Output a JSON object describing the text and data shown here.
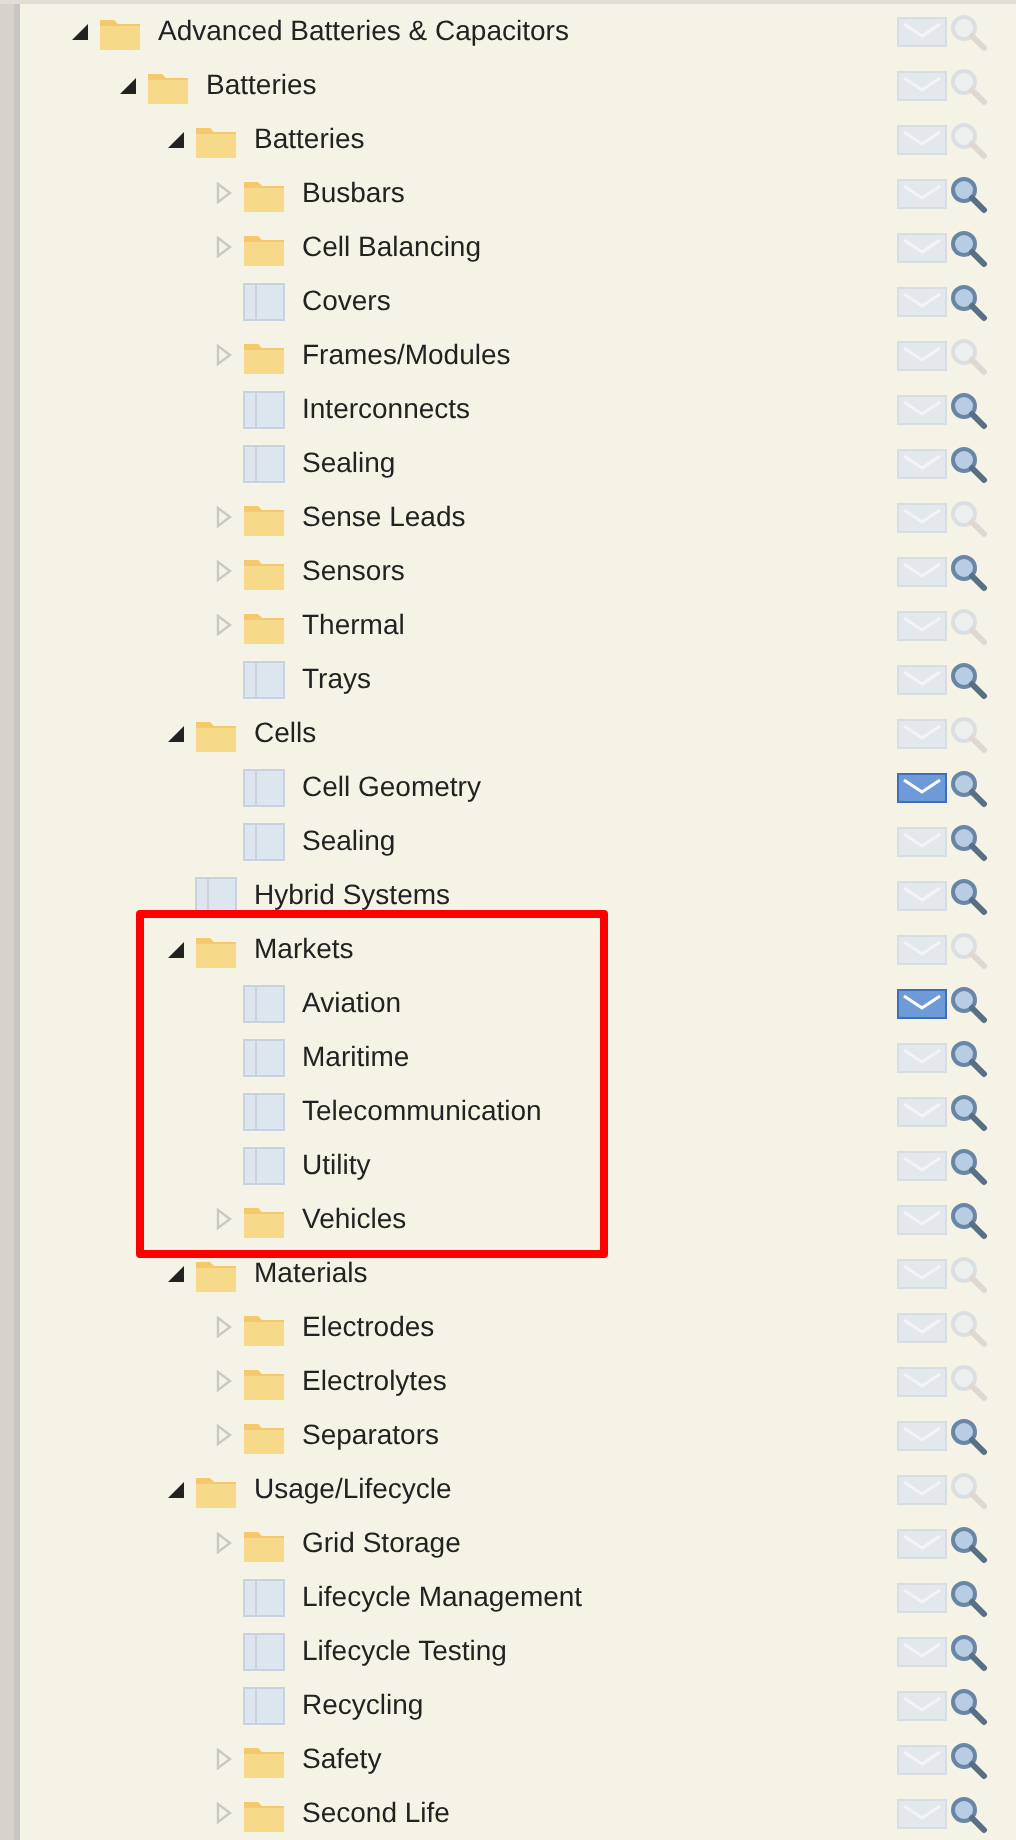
{
  "tree": [
    {
      "label": "Advanced Batteries & Capacitors",
      "kind": "folder",
      "expanded": true,
      "subscribed": false,
      "search_enabled": false,
      "children": [
        {
          "label": "Batteries",
          "kind": "folder",
          "expanded": true,
          "subscribed": false,
          "search_enabled": false,
          "children": [
            {
              "label": "Batteries",
              "kind": "folder",
              "expanded": true,
              "subscribed": false,
              "search_enabled": false,
              "children": [
                {
                  "label": "Busbars",
                  "kind": "folder",
                  "expanded": false,
                  "subscribed": false,
                  "search_enabled": true
                },
                {
                  "label": "Cell Balancing",
                  "kind": "folder",
                  "expanded": false,
                  "subscribed": false,
                  "search_enabled": true
                },
                {
                  "label": "Covers",
                  "kind": "document",
                  "subscribed": false,
                  "search_enabled": true
                },
                {
                  "label": "Frames/Modules",
                  "kind": "folder",
                  "expanded": false,
                  "subscribed": false,
                  "search_enabled": false
                },
                {
                  "label": "Interconnects",
                  "kind": "document",
                  "subscribed": false,
                  "search_enabled": true
                },
                {
                  "label": "Sealing",
                  "kind": "document",
                  "subscribed": false,
                  "search_enabled": true
                },
                {
                  "label": "Sense Leads",
                  "kind": "folder",
                  "expanded": false,
                  "subscribed": false,
                  "search_enabled": false
                },
                {
                  "label": "Sensors",
                  "kind": "folder",
                  "expanded": false,
                  "subscribed": false,
                  "search_enabled": true
                },
                {
                  "label": "Thermal",
                  "kind": "folder",
                  "expanded": false,
                  "subscribed": false,
                  "search_enabled": false
                },
                {
                  "label": "Trays",
                  "kind": "document",
                  "subscribed": false,
                  "search_enabled": true
                }
              ]
            },
            {
              "label": "Cells",
              "kind": "folder",
              "expanded": true,
              "subscribed": false,
              "search_enabled": false,
              "children": [
                {
                  "label": "Cell Geometry",
                  "kind": "document",
                  "subscribed": true,
                  "search_enabled": true
                },
                {
                  "label": "Sealing",
                  "kind": "document",
                  "subscribed": false,
                  "search_enabled": true
                }
              ]
            },
            {
              "label": "Hybrid Systems",
              "kind": "document",
              "subscribed": false,
              "search_enabled": true
            },
            {
              "label": "Markets",
              "kind": "folder",
              "expanded": true,
              "highlighted": true,
              "subscribed": false,
              "search_enabled": false,
              "children": [
                {
                  "label": "Aviation",
                  "kind": "document",
                  "subscribed": true,
                  "search_enabled": true
                },
                {
                  "label": "Maritime",
                  "kind": "document",
                  "subscribed": false,
                  "search_enabled": true
                },
                {
                  "label": "Telecommunication",
                  "kind": "document",
                  "subscribed": false,
                  "search_enabled": true
                },
                {
                  "label": "Utility",
                  "kind": "document",
                  "subscribed": false,
                  "search_enabled": true
                },
                {
                  "label": "Vehicles",
                  "kind": "folder",
                  "expanded": false,
                  "subscribed": false,
                  "search_enabled": true
                }
              ]
            },
            {
              "label": "Materials",
              "kind": "folder",
              "expanded": true,
              "subscribed": false,
              "search_enabled": false,
              "children": [
                {
                  "label": "Electrodes",
                  "kind": "folder",
                  "expanded": false,
                  "subscribed": false,
                  "search_enabled": false
                },
                {
                  "label": "Electrolytes",
                  "kind": "folder",
                  "expanded": false,
                  "subscribed": false,
                  "search_enabled": false
                },
                {
                  "label": "Separators",
                  "kind": "folder",
                  "expanded": false,
                  "subscribed": false,
                  "search_enabled": true
                }
              ]
            },
            {
              "label": "Usage/Lifecycle",
              "kind": "folder",
              "expanded": true,
              "subscribed": false,
              "search_enabled": false,
              "children": [
                {
                  "label": "Grid Storage",
                  "kind": "folder",
                  "expanded": false,
                  "subscribed": false,
                  "search_enabled": true
                },
                {
                  "label": "Lifecycle Management",
                  "kind": "document",
                  "subscribed": false,
                  "search_enabled": true
                },
                {
                  "label": "Lifecycle Testing",
                  "kind": "document",
                  "subscribed": false,
                  "search_enabled": true
                },
                {
                  "label": "Recycling",
                  "kind": "document",
                  "subscribed": false,
                  "search_enabled": true
                },
                {
                  "label": "Safety",
                  "kind": "folder",
                  "expanded": false,
                  "subscribed": false,
                  "search_enabled": true
                },
                {
                  "label": "Second Life",
                  "kind": "folder",
                  "expanded": false,
                  "subscribed": false,
                  "search_enabled": true
                }
              ]
            }
          ]
        }
      ]
    }
  ]
}
